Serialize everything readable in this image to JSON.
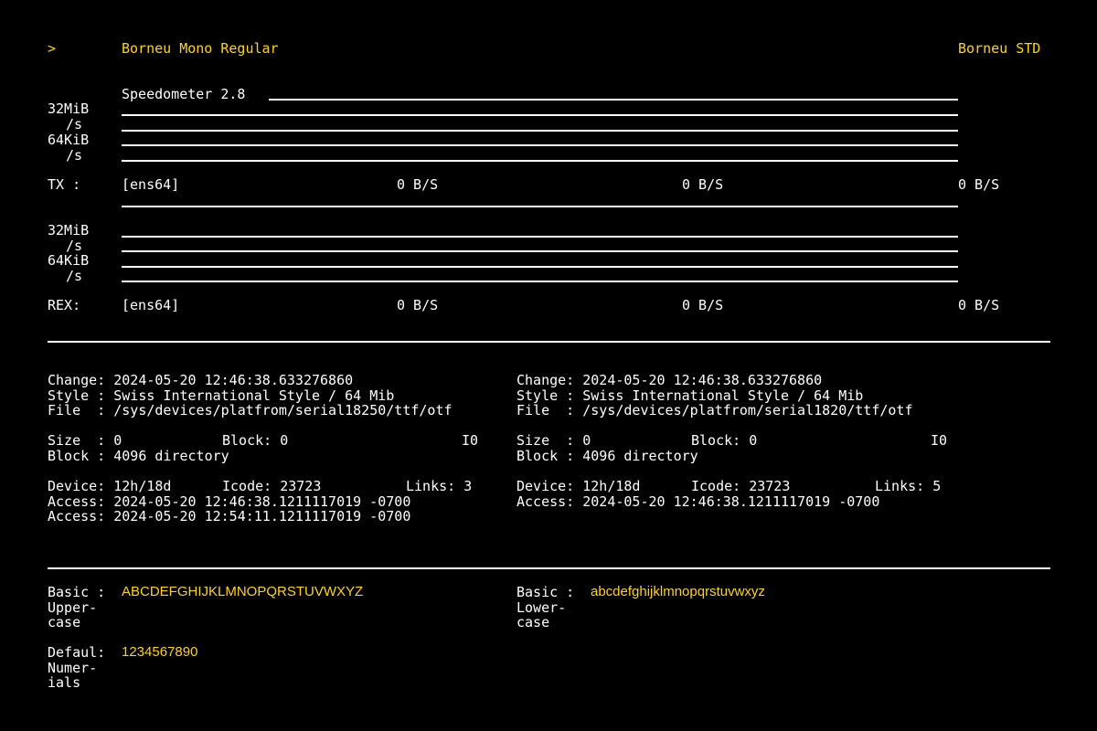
{
  "header": {
    "prompt_symbol": ">",
    "font_name": "Borneu Mono Regular",
    "brand": "Borneu STD"
  },
  "speedometer": {
    "title": "Speedometer 2.8",
    "tx": {
      "scale_top": "32MiB",
      "scale_top_unit": "/s",
      "scale_bottom": "64KiB",
      "scale_bottom_unit": "/s",
      "label": "TX :",
      "interface": "[ens64]",
      "readings": [
        "0 B/S",
        "0 B/S",
        "0 B/S"
      ]
    },
    "rex": {
      "scale_top": "32MiB",
      "scale_top_unit": "/s",
      "scale_bottom": "64KiB",
      "scale_bottom_unit": "/s",
      "label": "REX:",
      "interface": "[ens64]",
      "readings": [
        "0 B/S",
        "0 B/S",
        "0 B/S"
      ]
    }
  },
  "file_info": [
    {
      "change": "Change: 2024-05-20 12:46:38.633276860",
      "style": "Style : Swiss International Style / 64 Mib",
      "file": "File  : /sys/devices/platfrom/serial18250/ttf/otf",
      "size": "Size  : 0",
      "block_inline": "Block: 0",
      "io": "I0",
      "block": "Block : 4096 directory",
      "device": "Device: 12h/18d",
      "icode": "Icode: 23723",
      "links": "Links: 3",
      "access_1": "Access: 2024-05-20 12:46:38.1211117019 -0700",
      "access_2": "Access: 2024-05-20 12:54:11.1211117019 -0700"
    },
    {
      "change": "Change: 2024-05-20 12:46:38.633276860",
      "style": "Style : Swiss International Style / 64 Mib",
      "file": "File  : /sys/devices/platfrom/serial1820/ttf/otf",
      "size": "Size  : 0",
      "block_inline": "Block: 0",
      "io": "I0",
      "block": "Block : 4096 directory",
      "device": "Device: 12h/18d",
      "icode": "Icode: 23723",
      "links": "Links: 5",
      "access_1": "Access: 2024-05-20 12:46:38.1211117019 -0700"
    }
  ],
  "glyphs": {
    "uppercase": {
      "label_1": "Basic :",
      "label_2": "Upper-",
      "label_3": "case",
      "sample": "ABCDEFGHIJKLMNOPQRSTUVWXYZ"
    },
    "lowercase": {
      "label_1": "Basic :",
      "label_2": "Lower-",
      "label_3": "case",
      "sample": "abcdefghijklmnopqrstuvwxyz"
    },
    "numerals": {
      "label_1": "Defaul:",
      "label_2": "Numer-",
      "label_3": "ials",
      "sample": "1234567890"
    }
  },
  "colors": {
    "background": "#000000",
    "text": "#ffffff",
    "accent": "#ffd21f"
  }
}
